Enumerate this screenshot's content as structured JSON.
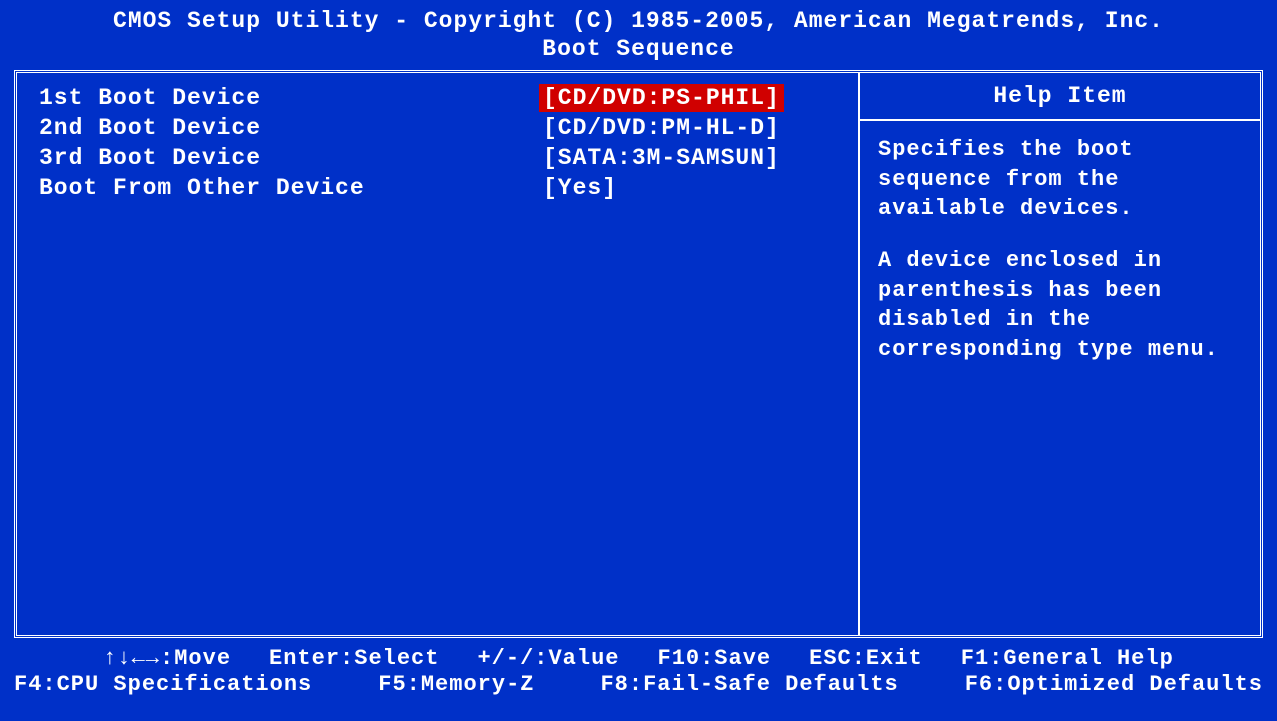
{
  "header": {
    "title": "CMOS Setup Utility - Copyright (C) 1985-2005, American Megatrends, Inc.",
    "subtitle": "Boot Sequence"
  },
  "settings": {
    "items": [
      {
        "label": "1st Boot Device",
        "value": "[CD/DVD:PS-PHIL]",
        "selected": true
      },
      {
        "label": "2nd Boot Device",
        "value": "[CD/DVD:PM-HL-D]",
        "selected": false
      },
      {
        "label": "3rd Boot Device",
        "value": "[SATA:3M-SAMSUN]",
        "selected": false
      },
      {
        "label": "Boot From Other Device",
        "value": "[Yes]",
        "selected": false
      }
    ]
  },
  "help": {
    "title": "Help Item",
    "para1": "Specifies the boot sequence from the available devices.",
    "para2": "A device enclosed in parenthesis has been disabled in the corresponding type menu."
  },
  "footer": {
    "line1": {
      "move": "↑↓←→:Move",
      "select": "Enter:Select",
      "value": "+/-/:Value",
      "save": "F10:Save",
      "exit": "ESC:Exit",
      "help": "F1:General Help"
    },
    "line2": {
      "cpu": "F4:CPU Specifications",
      "memory": "F5:Memory-Z",
      "failsafe": "F8:Fail-Safe Defaults",
      "optimized": "F6:Optimized Defaults"
    }
  }
}
